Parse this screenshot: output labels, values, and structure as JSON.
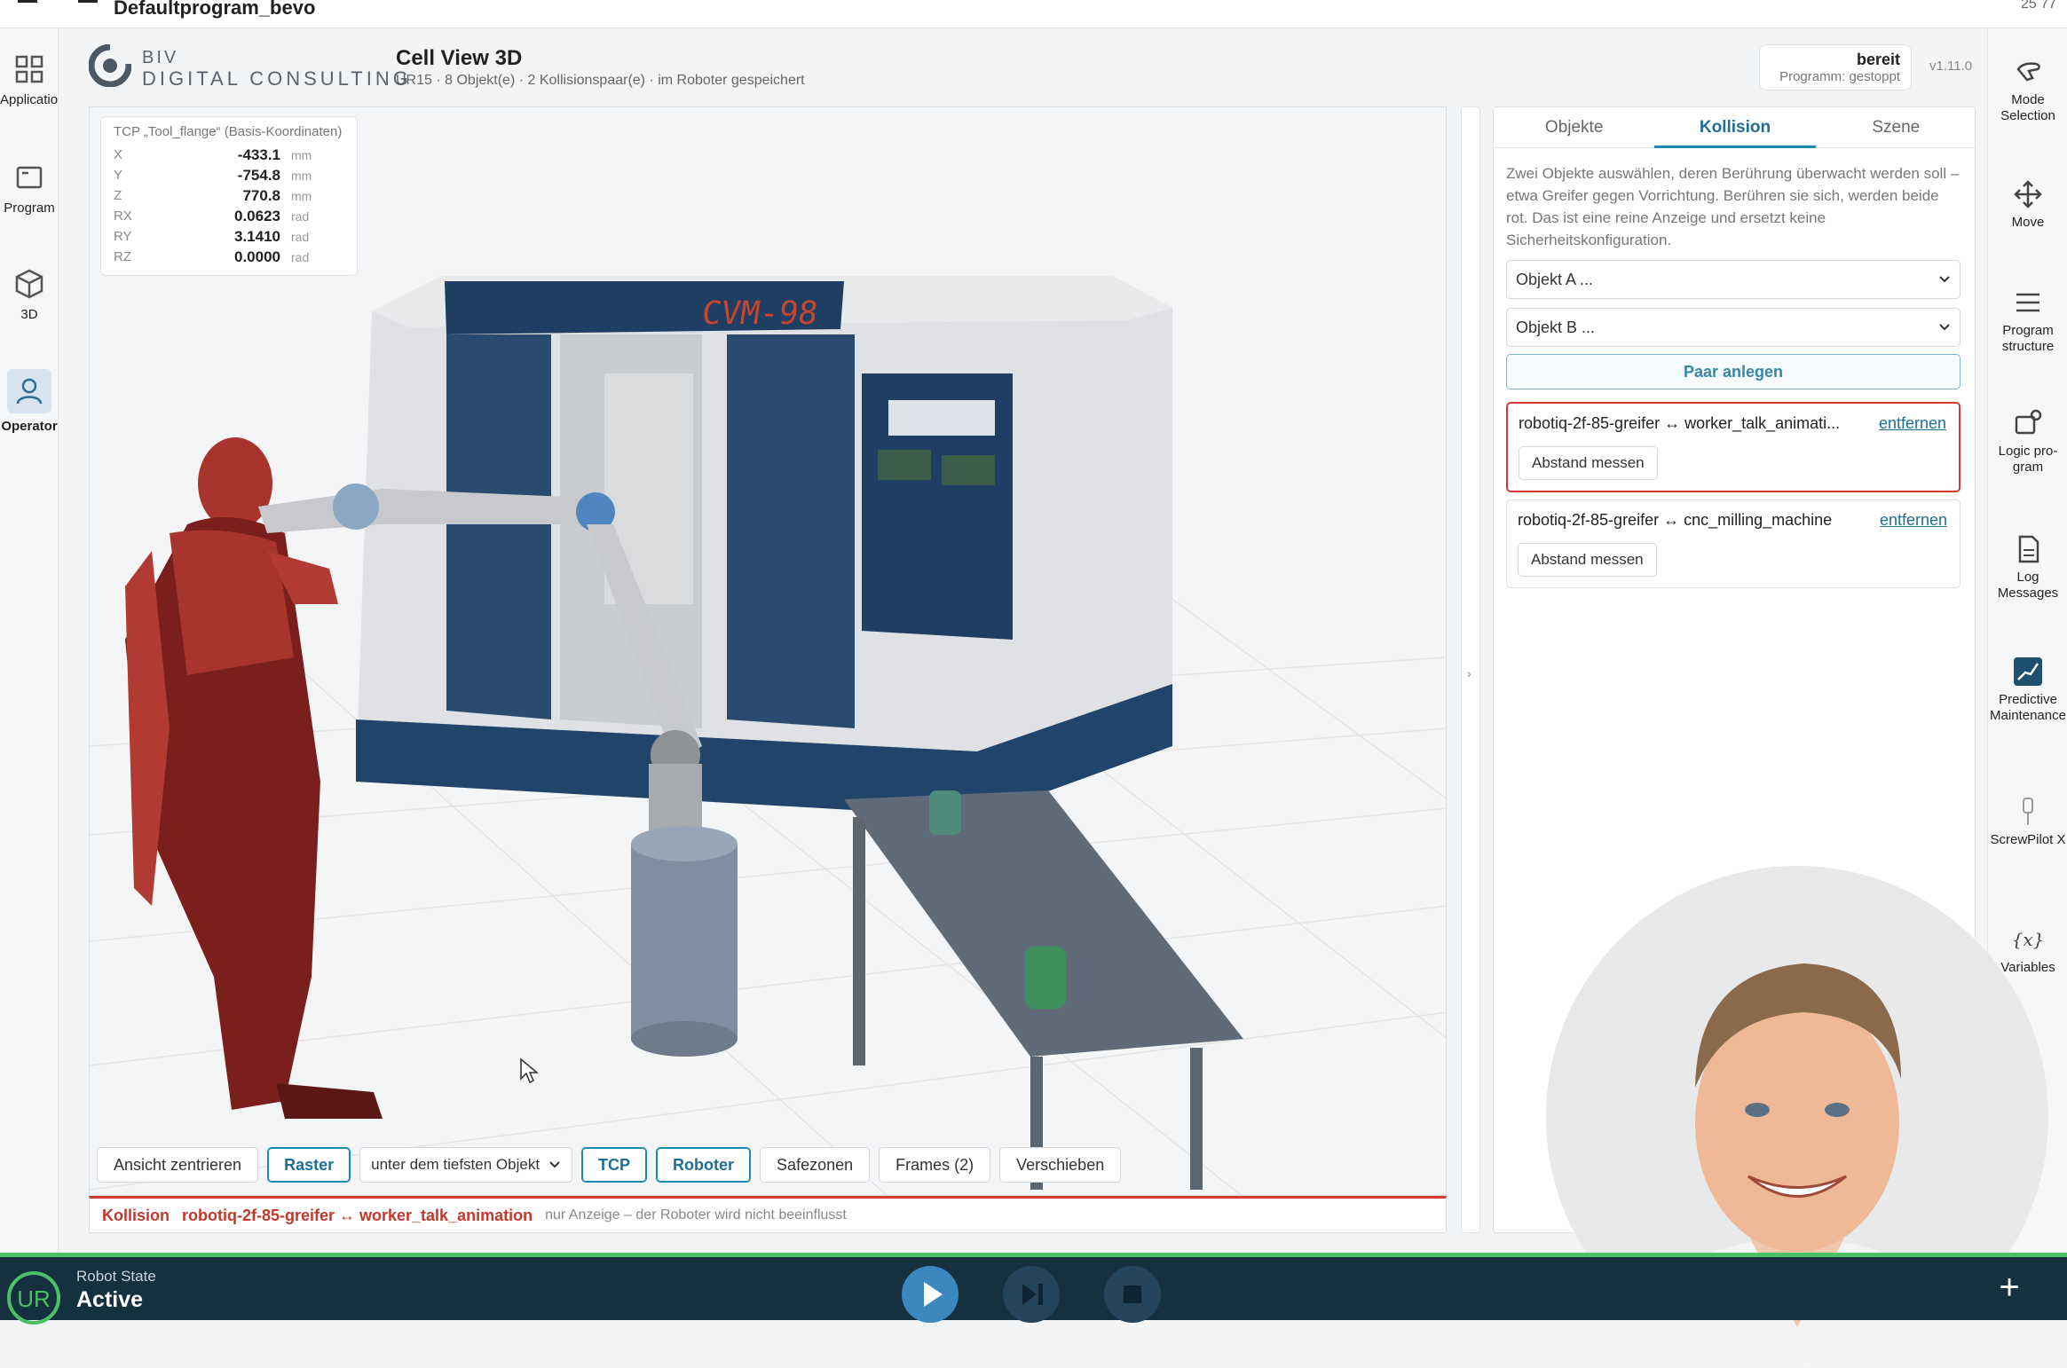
{
  "window": {
    "title": "Defaultprogram_bevo",
    "clock": "25 77"
  },
  "left_nav": [
    {
      "label": "Application",
      "icon": "grid-icon"
    },
    {
      "label": "Program",
      "icon": "program-icon"
    },
    {
      "label": "3D",
      "icon": "cube-icon"
    },
    {
      "label": "Operator",
      "icon": "person-icon"
    }
  ],
  "right_nav": [
    {
      "label": "Mode Selection",
      "icon": "hand-icon"
    },
    {
      "label": "Move",
      "icon": "move-arrows-icon"
    },
    {
      "label": "Program structure",
      "icon": "list-icon"
    },
    {
      "label": "Logic pro-gram",
      "icon": "logic-program-icon"
    },
    {
      "label": "Log Messages",
      "icon": "document-icon"
    },
    {
      "label": "Predictive Maintenance",
      "icon": "chart-icon"
    },
    {
      "label": "ScrewPilot X",
      "icon": "screwdriver-icon"
    },
    {
      "label": "Variables",
      "icon": "variables-icon"
    }
  ],
  "brand": {
    "line1": "BIV",
    "line2": "DIGITAL CONSULTING"
  },
  "header": {
    "title": "Cell View 3D",
    "subtitle": "UR15 · 8 Objekt(e) · 2 Kollisionspaar(e) · im Roboter gespeichert"
  },
  "status": {
    "state": "bereit",
    "program": "Programm: gestoppt",
    "version": "v1.11.0"
  },
  "tcp": {
    "header": "TCP „Tool_flange“ (Basis-Koordinaten)",
    "rows": [
      {
        "axis": "X",
        "value": "-433.1",
        "unit": "mm"
      },
      {
        "axis": "Y",
        "value": "-754.8",
        "unit": "mm"
      },
      {
        "axis": "Z",
        "value": "770.8",
        "unit": "mm"
      },
      {
        "axis": "RX",
        "value": "0.0623",
        "unit": "rad"
      },
      {
        "axis": "RY",
        "value": "3.1410",
        "unit": "rad"
      },
      {
        "axis": "RZ",
        "value": "0.0000",
        "unit": "rad"
      }
    ]
  },
  "scene": {
    "machine_label": "CVM-98"
  },
  "toolbar": {
    "center": "Ansicht zentrieren",
    "raster": "Raster",
    "placement": "unter dem tiefsten Objekt",
    "tcp": "TCP",
    "robot": "Roboter",
    "safezones": "Safezonen",
    "frames": "Frames (2)",
    "move": "Verschieben"
  },
  "collision_bar": {
    "label": "Kollision",
    "pair": "robotiq-2f-85-greifer ↔ worker_talk_animation",
    "note": "nur Anzeige – der Roboter wird nicht beeinflusst"
  },
  "panel": {
    "tabs": [
      "Objekte",
      "Kollision",
      "Szene"
    ],
    "active_tab": "Kollision",
    "description": "Zwei Objekte auswählen, deren Berührung überwacht werden soll – etwa Greifer gegen Vorrichtung. Berühren sie sich, werden beide rot. Das ist eine reine Anzeige und ersetzt keine Sicherheitskonfiguration.",
    "object_a": "Objekt A ...",
    "object_b": "Objekt B ...",
    "add_pair": "Paar anlegen",
    "pairs": [
      {
        "name": "robotiq-2f-85-greifer ↔ worker_talk_animati...",
        "remove": "entfernen",
        "measure": "Abstand messen",
        "colliding": true
      },
      {
        "name": "robotiq-2f-85-greifer ↔ cnc_milling_machine",
        "remove": "entfernen",
        "measure": "Abstand messen",
        "colliding": false
      }
    ]
  },
  "bottom": {
    "robot_state_label": "Robot State",
    "robot_state": "Active"
  },
  "colors": {
    "accent": "#1e88b4",
    "alert": "#d93a30",
    "bottom_bg": "#15303f",
    "ok_green": "#4cc067"
  }
}
